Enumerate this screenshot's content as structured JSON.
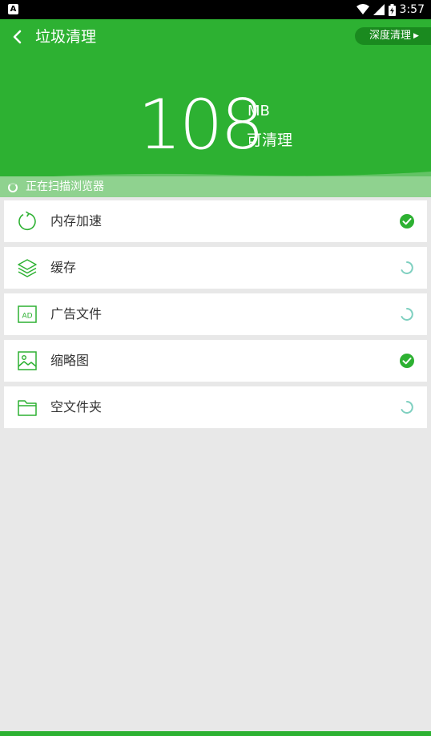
{
  "status_bar": {
    "app_badge": "A",
    "time": "3:57"
  },
  "header": {
    "title": "垃圾清理",
    "deep_clean_label": "深度清理"
  },
  "summary": {
    "size_value": "108",
    "size_unit": "MB",
    "size_desc": "可清理"
  },
  "scan": {
    "status_text": "正在扫描浏览器"
  },
  "items": [
    {
      "label": "内存加速",
      "icon": "memory-boost-icon",
      "status": "done"
    },
    {
      "label": "缓存",
      "icon": "layers-icon",
      "status": "scanning"
    },
    {
      "label": "广告文件",
      "icon": "ad-icon",
      "status": "scanning"
    },
    {
      "label": "缩略图",
      "icon": "image-icon",
      "status": "done"
    },
    {
      "label": "空文件夹",
      "icon": "folder-icon",
      "status": "scanning"
    }
  ],
  "colors": {
    "brand_green": "#2db132",
    "check_green": "#2db132",
    "spinner_teal": "#7fd0c0"
  }
}
